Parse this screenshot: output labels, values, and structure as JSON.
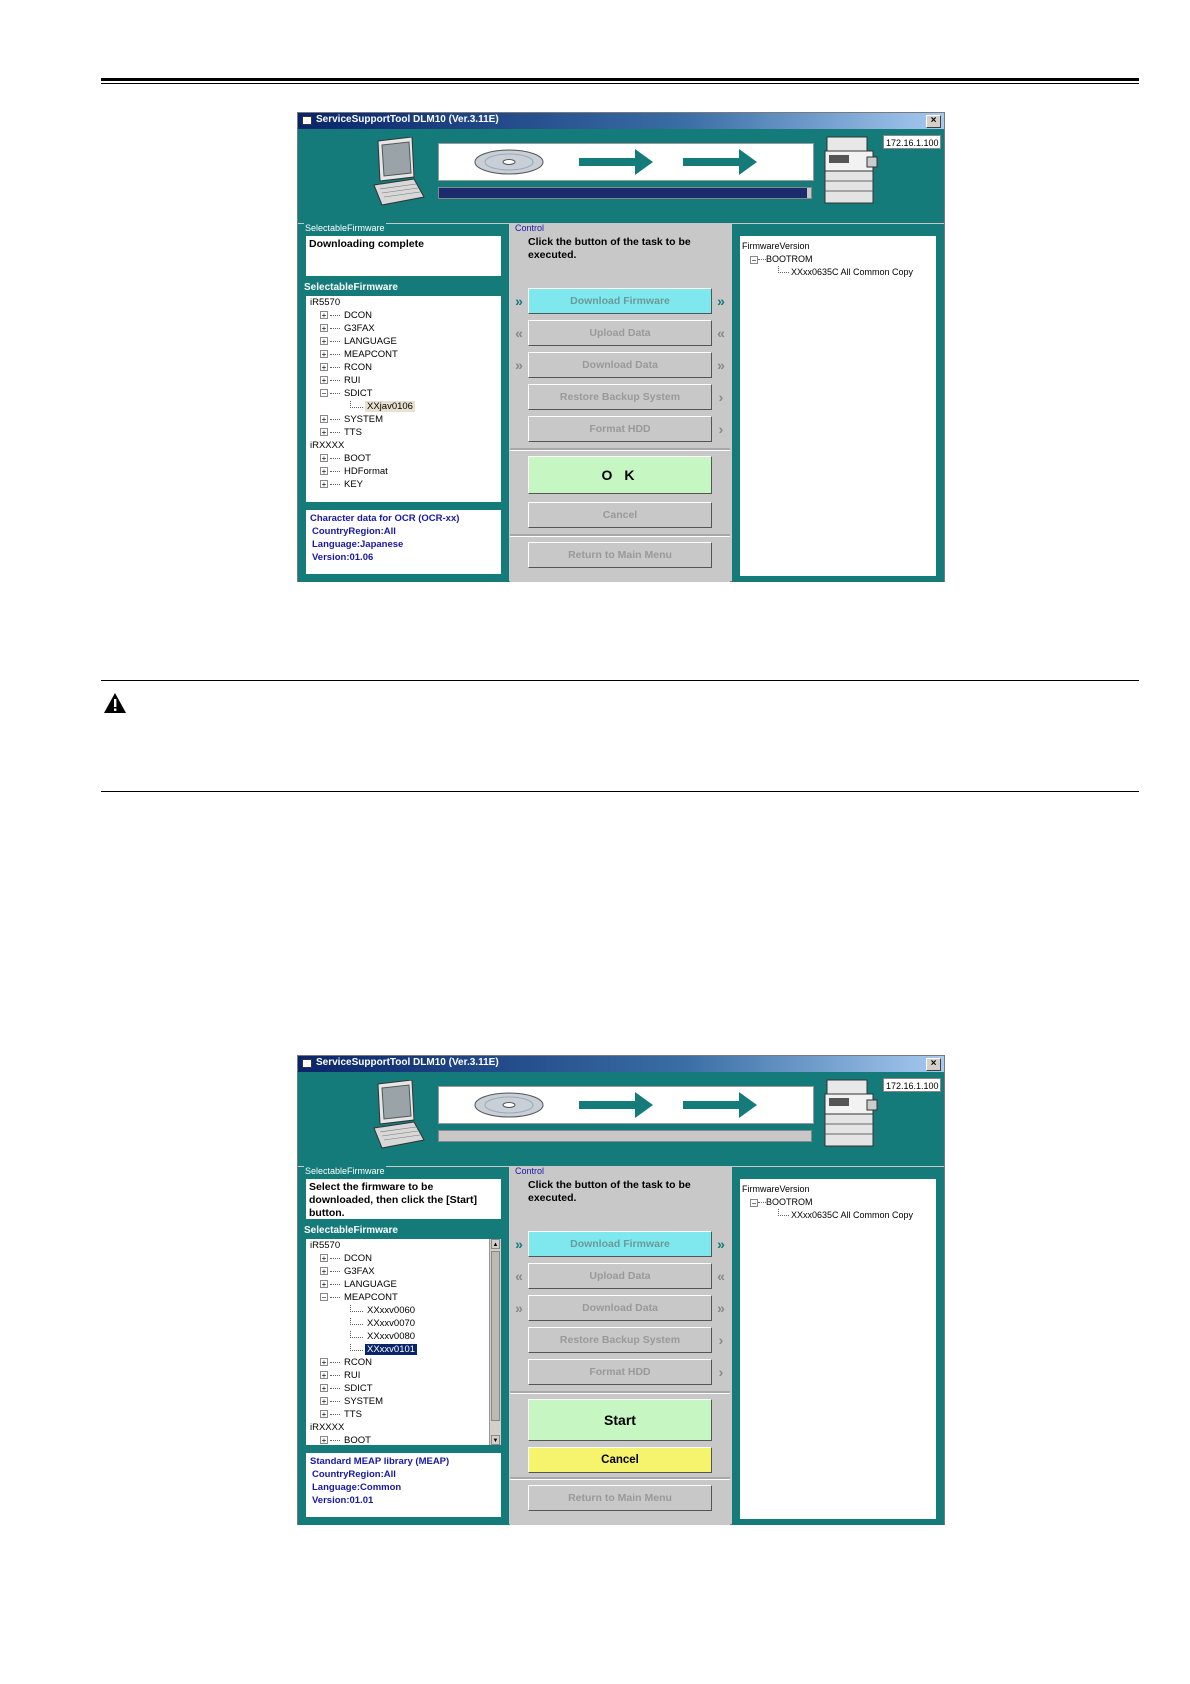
{
  "windows": [
    {
      "title": "ServiceSupportTool DLM10 (Ver.3.11E)",
      "close_label": "×",
      "ip_address": "172.16.1.100",
      "progress_fraction": 0.99,
      "left_group_label": "SelectableFirmware",
      "message": "Downloading complete",
      "selectable_header": "SelectableFirmware",
      "tree": [
        {
          "label": "iR5570",
          "level": 0,
          "toggle": ""
        },
        {
          "label": "DCON",
          "level": 1,
          "toggle": "+"
        },
        {
          "label": "G3FAX",
          "level": 1,
          "toggle": "+"
        },
        {
          "label": "LANGUAGE",
          "level": 1,
          "toggle": "+"
        },
        {
          "label": "MEAPCONT",
          "level": 1,
          "toggle": "+"
        },
        {
          "label": "RCON",
          "level": 1,
          "toggle": "+"
        },
        {
          "label": "RUI",
          "level": 1,
          "toggle": "+"
        },
        {
          "label": "SDICT",
          "level": 1,
          "toggle": "−"
        },
        {
          "label": "XXjav0106",
          "level": 2,
          "toggle": "",
          "selected": "light"
        },
        {
          "label": "SYSTEM",
          "level": 1,
          "toggle": "+"
        },
        {
          "label": "TTS",
          "level": 1,
          "toggle": "+"
        },
        {
          "label": "iRXXXX",
          "level": 0,
          "toggle": ""
        },
        {
          "label": "BOOT",
          "level": 1,
          "toggle": "+"
        },
        {
          "label": "HDFormat",
          "level": 1,
          "toggle": "+"
        },
        {
          "label": "KEY",
          "level": 1,
          "toggle": "+"
        }
      ],
      "info": [
        "Character data for OCR (OCR-xx)",
        "CountryRegion:All",
        "Language:Japanese",
        "Version:01.06"
      ],
      "control_group_label": "Control",
      "control_text": "Click the button of the task to be executed.",
      "buttons": {
        "download_firmware": "Download Firmware",
        "upload_data": "Upload Data",
        "download_data": "Download Data",
        "restore_backup": "Restore Backup System",
        "format_hdd": "Format HDD",
        "primary": "O  K",
        "cancel": "Cancel",
        "return_main": "Return to Main Menu"
      },
      "firmware_version_label": "FirmwareVersion",
      "bootrom_label": "BOOTROM",
      "bootrom_version": "XXxx0635C All Common Copy",
      "has_scrollbar": false
    },
    {
      "title": "ServiceSupportTool DLM10 (Ver.3.11E)",
      "close_label": "×",
      "ip_address": "172.16.1.100",
      "progress_fraction": 0,
      "left_group_label": "SelectableFirmware",
      "message": "Select the firmware to be downloaded, then click the [Start] button.",
      "selectable_header": "SelectableFirmware",
      "tree": [
        {
          "label": "iR5570",
          "level": 0,
          "toggle": ""
        },
        {
          "label": "DCON",
          "level": 1,
          "toggle": "+"
        },
        {
          "label": "G3FAX",
          "level": 1,
          "toggle": "+"
        },
        {
          "label": "LANGUAGE",
          "level": 1,
          "toggle": "+"
        },
        {
          "label": "MEAPCONT",
          "level": 1,
          "toggle": "−"
        },
        {
          "label": "XXxxv0060",
          "level": 2,
          "toggle": ""
        },
        {
          "label": "XXxxv0070",
          "level": 2,
          "toggle": ""
        },
        {
          "label": "XXxxv0080",
          "level": 2,
          "toggle": ""
        },
        {
          "label": "XXxxv0101",
          "level": 2,
          "toggle": "",
          "selected": "dark"
        },
        {
          "label": "RCON",
          "level": 1,
          "toggle": "+"
        },
        {
          "label": "RUI",
          "level": 1,
          "toggle": "+"
        },
        {
          "label": "SDICT",
          "level": 1,
          "toggle": "+"
        },
        {
          "label": "SYSTEM",
          "level": 1,
          "toggle": "+"
        },
        {
          "label": "TTS",
          "level": 1,
          "toggle": "+"
        },
        {
          "label": "iRXXXX",
          "level": 0,
          "toggle": ""
        },
        {
          "label": "BOOT",
          "level": 1,
          "toggle": "+"
        }
      ],
      "info": [
        "Standard MEAP library (MEAP)",
        "CountryRegion:All",
        "Language:Common",
        "Version:01.01"
      ],
      "control_group_label": "Control",
      "control_text": "Click the button of the task to be executed.",
      "buttons": {
        "download_firmware": "Download Firmware",
        "upload_data": "Upload Data",
        "download_data": "Download Data",
        "restore_backup": "Restore Backup System",
        "format_hdd": "Format HDD",
        "primary": "Start",
        "cancel": "Cancel",
        "return_main": "Return to Main Menu"
      },
      "firmware_version_label": "FirmwareVersion",
      "bootrom_label": "BOOTROM",
      "bootrom_version": "XXxx0635C All Common Copy",
      "has_scrollbar": true
    }
  ],
  "icons": {
    "warning": "warning-triangle-icon",
    "laptop": "laptop-icon",
    "disc": "cd-disc-icon",
    "printer": "copier-printer-icon",
    "arrow": "flow-arrow-icon"
  },
  "colors": {
    "panel_teal": "#147a7a",
    "download_firmware_cyan": "#7fe8ee",
    "ok_green": "#c6f7c2",
    "cancel_yellow": "#f6f46c",
    "info_text_blue": "#1818a8",
    "progress_navy": "#1c2a6e"
  }
}
